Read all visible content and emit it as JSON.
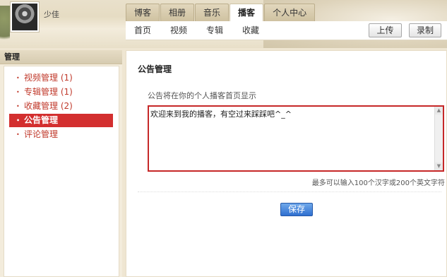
{
  "header": {
    "username": "少佳",
    "tabs": [
      "博客",
      "相册",
      "音乐",
      "播客",
      "个人中心"
    ],
    "active_tab": 3,
    "subnav": [
      "首页",
      "视频",
      "专辑",
      "收藏"
    ],
    "upload_label": "上传",
    "record_label": "录制"
  },
  "sidebar": {
    "title": "管理",
    "items": [
      {
        "label": "视频管理 (1)"
      },
      {
        "label": "专辑管理 (1)"
      },
      {
        "label": "收藏管理 (2)"
      },
      {
        "label": "公告管理"
      },
      {
        "label": "评论管理"
      }
    ],
    "active_index": 3
  },
  "main": {
    "heading": "公告管理",
    "hint": "公告将在你的个人播客首页显示",
    "textarea_value": "欢迎来到我的播客，有空过来踩踩吧^_^",
    "limit_text": "最多可以输入100个汉字或200个英文字符",
    "save_label": "保存"
  },
  "colors": {
    "accent_red": "#d32f2f",
    "link_red": "#c0392b",
    "save_blue": "#2f6fd0"
  },
  "icons": [
    "bullet-icon",
    "scroll-up-icon",
    "scroll-down-icon"
  ]
}
